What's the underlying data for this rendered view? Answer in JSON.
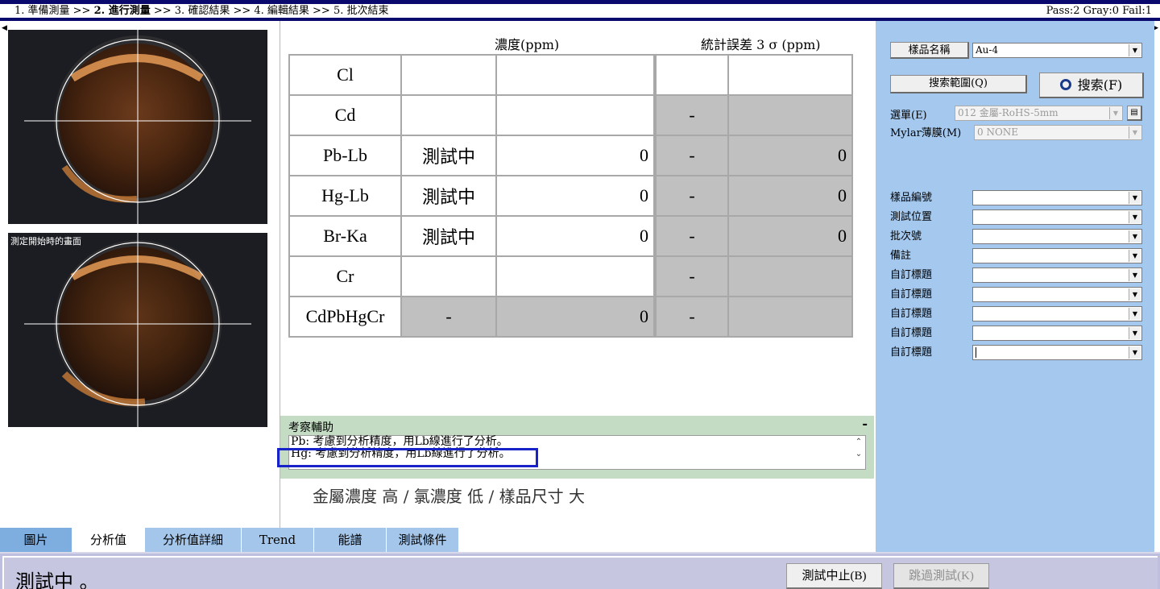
{
  "header": {
    "steps": [
      {
        "label": "1. 準備測量 >>",
        "active": false
      },
      {
        "label": "2. 進行測量",
        "active": true
      },
      {
        "label": ">> 3. 確認結果 >> 4. 編輯結果 >> 5. 批次結束",
        "active": false
      }
    ],
    "counts": "Pass:2  Gray:0  Fail:1"
  },
  "images": {
    "second_label": "測定開始時的畫面"
  },
  "results": {
    "col_concentration": "濃度(ppm)",
    "col_sigma": "統計誤差 3 σ (ppm)",
    "rows": [
      {
        "name": "Cl",
        "status": "",
        "value": "",
        "dash": "",
        "sigma": "",
        "gray": false
      },
      {
        "name": "Cd",
        "status": "",
        "value": "",
        "dash": "-",
        "sigma": "",
        "gray": true
      },
      {
        "name": "Pb-Lb",
        "status": "測試中",
        "value": "0",
        "dash": "-",
        "sigma": "0",
        "gray": true
      },
      {
        "name": "Hg-Lb",
        "status": "測試中",
        "value": "0",
        "dash": "-",
        "sigma": "0",
        "gray": true
      },
      {
        "name": "Br-Ka",
        "status": "測試中",
        "value": "0",
        "dash": "-",
        "sigma": "0",
        "gray": true
      },
      {
        "name": "Cr",
        "status": "",
        "value": "",
        "dash": "-",
        "sigma": "",
        "gray": true
      },
      {
        "name": "CdPbHgCr",
        "status": "-",
        "value": "0",
        "dash": "-",
        "sigma": "",
        "gray": true,
        "all_gray": true
      }
    ]
  },
  "advice": {
    "title": "考察輔助",
    "minimize": "-",
    "lines": [
      "Pb: 考慮到分析精度，用Lb線進行了分析。",
      "Hg: 考慮到分析精度，用Lb線進行了分析。"
    ],
    "summary": "金屬濃度 高 / 氯濃度 低 / 樣品尺寸 大"
  },
  "tabs": [
    {
      "label": "圖片",
      "active": false
    },
    {
      "label": "分析值",
      "active": true
    },
    {
      "label": "分析值詳細",
      "active": false
    },
    {
      "label": "Trend",
      "active": false
    },
    {
      "label": "能譜",
      "active": false
    },
    {
      "label": "測試條件",
      "active": false
    }
  ],
  "status": {
    "text": "測試中 。",
    "stop_button": "測試中止(B)",
    "skip_button": "跳過測試(K)"
  },
  "right_panel": {
    "sample_name_button": "樣品名稱",
    "sample_name_value": "Au-4",
    "search_range_button": "搜索範圍(Q)",
    "search_button": "搜索(F)",
    "menu_label": "選單(E)",
    "menu_value": "012 金屬-RoHS-5mm",
    "mylar_label": "Mylar薄膜(M)",
    "mylar_value": "0 NONE",
    "fields": [
      {
        "label": "樣品編號",
        "value": ""
      },
      {
        "label": "測試位置",
        "value": ""
      },
      {
        "label": "批次號",
        "value": ""
      },
      {
        "label": "備註",
        "value": ""
      },
      {
        "label": "自訂標題",
        "value": ""
      },
      {
        "label": "自訂標題",
        "value": ""
      },
      {
        "label": "自訂標題",
        "value": ""
      },
      {
        "label": "自訂標題",
        "value": ""
      },
      {
        "label": "自訂標題",
        "value": ""
      }
    ]
  }
}
